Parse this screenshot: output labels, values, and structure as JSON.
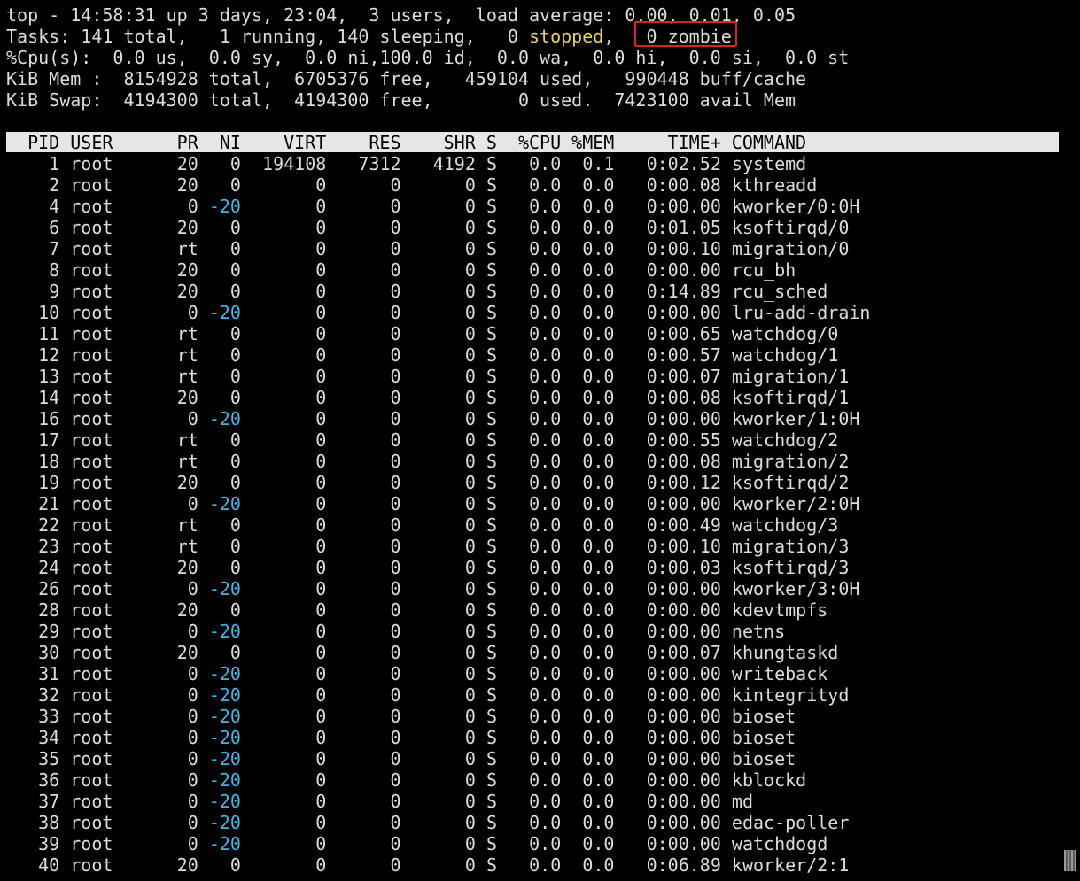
{
  "summary": {
    "line1": "top - 14:58:31 up 3 days, 23:04,  3 users,  load average: 0.00, 0.01, 0.05",
    "line2_a": "Tasks: 141 total,   1 running, 140 sleeping,   0 ",
    "line2_stopped": "stopped",
    "line2_b": ",   ",
    "line2_zombie": "0 zombie",
    "line3": "%Cpu(s):  0.0 us,  0.0 sy,  0.0 ni,100.0 id,  0.0 wa,  0.0 hi,  0.0 si,  0.0 st",
    "line4": "KiB Mem :  8154928 total,  6705376 free,   459104 used,   990448 buff/cache",
    "line5": "KiB Swap:  4194300 total,  4194300 free,        0 used.  7423100 avail Mem"
  },
  "table": {
    "header": "  PID USER      PR  NI    VIRT    RES    SHR S  %CPU %MEM     TIME+ COMMAND",
    "rows": [
      {
        "pid": "1",
        "user": "root",
        "pr": "20",
        "ni": "0",
        "virt": "194108",
        "res": "7312",
        "shr": "4192",
        "s": "S",
        "cpu": "0.0",
        "mem": "0.1",
        "time": "0:02.52",
        "cmd": "systemd"
      },
      {
        "pid": "2",
        "user": "root",
        "pr": "20",
        "ni": "0",
        "virt": "0",
        "res": "0",
        "shr": "0",
        "s": "S",
        "cpu": "0.0",
        "mem": "0.0",
        "time": "0:00.08",
        "cmd": "kthreadd"
      },
      {
        "pid": "4",
        "user": "root",
        "pr": "0",
        "ni": "-20",
        "virt": "0",
        "res": "0",
        "shr": "0",
        "s": "S",
        "cpu": "0.0",
        "mem": "0.0",
        "time": "0:00.00",
        "cmd": "kworker/0:0H"
      },
      {
        "pid": "6",
        "user": "root",
        "pr": "20",
        "ni": "0",
        "virt": "0",
        "res": "0",
        "shr": "0",
        "s": "S",
        "cpu": "0.0",
        "mem": "0.0",
        "time": "0:01.05",
        "cmd": "ksoftirqd/0"
      },
      {
        "pid": "7",
        "user": "root",
        "pr": "rt",
        "ni": "0",
        "virt": "0",
        "res": "0",
        "shr": "0",
        "s": "S",
        "cpu": "0.0",
        "mem": "0.0",
        "time": "0:00.10",
        "cmd": "migration/0"
      },
      {
        "pid": "8",
        "user": "root",
        "pr": "20",
        "ni": "0",
        "virt": "0",
        "res": "0",
        "shr": "0",
        "s": "S",
        "cpu": "0.0",
        "mem": "0.0",
        "time": "0:00.00",
        "cmd": "rcu_bh"
      },
      {
        "pid": "9",
        "user": "root",
        "pr": "20",
        "ni": "0",
        "virt": "0",
        "res": "0",
        "shr": "0",
        "s": "S",
        "cpu": "0.0",
        "mem": "0.0",
        "time": "0:14.89",
        "cmd": "rcu_sched"
      },
      {
        "pid": "10",
        "user": "root",
        "pr": "0",
        "ni": "-20",
        "virt": "0",
        "res": "0",
        "shr": "0",
        "s": "S",
        "cpu": "0.0",
        "mem": "0.0",
        "time": "0:00.00",
        "cmd": "lru-add-drain"
      },
      {
        "pid": "11",
        "user": "root",
        "pr": "rt",
        "ni": "0",
        "virt": "0",
        "res": "0",
        "shr": "0",
        "s": "S",
        "cpu": "0.0",
        "mem": "0.0",
        "time": "0:00.65",
        "cmd": "watchdog/0"
      },
      {
        "pid": "12",
        "user": "root",
        "pr": "rt",
        "ni": "0",
        "virt": "0",
        "res": "0",
        "shr": "0",
        "s": "S",
        "cpu": "0.0",
        "mem": "0.0",
        "time": "0:00.57",
        "cmd": "watchdog/1"
      },
      {
        "pid": "13",
        "user": "root",
        "pr": "rt",
        "ni": "0",
        "virt": "0",
        "res": "0",
        "shr": "0",
        "s": "S",
        "cpu": "0.0",
        "mem": "0.0",
        "time": "0:00.07",
        "cmd": "migration/1"
      },
      {
        "pid": "14",
        "user": "root",
        "pr": "20",
        "ni": "0",
        "virt": "0",
        "res": "0",
        "shr": "0",
        "s": "S",
        "cpu": "0.0",
        "mem": "0.0",
        "time": "0:00.08",
        "cmd": "ksoftirqd/1"
      },
      {
        "pid": "16",
        "user": "root",
        "pr": "0",
        "ni": "-20",
        "virt": "0",
        "res": "0",
        "shr": "0",
        "s": "S",
        "cpu": "0.0",
        "mem": "0.0",
        "time": "0:00.00",
        "cmd": "kworker/1:0H"
      },
      {
        "pid": "17",
        "user": "root",
        "pr": "rt",
        "ni": "0",
        "virt": "0",
        "res": "0",
        "shr": "0",
        "s": "S",
        "cpu": "0.0",
        "mem": "0.0",
        "time": "0:00.55",
        "cmd": "watchdog/2"
      },
      {
        "pid": "18",
        "user": "root",
        "pr": "rt",
        "ni": "0",
        "virt": "0",
        "res": "0",
        "shr": "0",
        "s": "S",
        "cpu": "0.0",
        "mem": "0.0",
        "time": "0:00.08",
        "cmd": "migration/2"
      },
      {
        "pid": "19",
        "user": "root",
        "pr": "20",
        "ni": "0",
        "virt": "0",
        "res": "0",
        "shr": "0",
        "s": "S",
        "cpu": "0.0",
        "mem": "0.0",
        "time": "0:00.12",
        "cmd": "ksoftirqd/2"
      },
      {
        "pid": "21",
        "user": "root",
        "pr": "0",
        "ni": "-20",
        "virt": "0",
        "res": "0",
        "shr": "0",
        "s": "S",
        "cpu": "0.0",
        "mem": "0.0",
        "time": "0:00.00",
        "cmd": "kworker/2:0H"
      },
      {
        "pid": "22",
        "user": "root",
        "pr": "rt",
        "ni": "0",
        "virt": "0",
        "res": "0",
        "shr": "0",
        "s": "S",
        "cpu": "0.0",
        "mem": "0.0",
        "time": "0:00.49",
        "cmd": "watchdog/3"
      },
      {
        "pid": "23",
        "user": "root",
        "pr": "rt",
        "ni": "0",
        "virt": "0",
        "res": "0",
        "shr": "0",
        "s": "S",
        "cpu": "0.0",
        "mem": "0.0",
        "time": "0:00.10",
        "cmd": "migration/3"
      },
      {
        "pid": "24",
        "user": "root",
        "pr": "20",
        "ni": "0",
        "virt": "0",
        "res": "0",
        "shr": "0",
        "s": "S",
        "cpu": "0.0",
        "mem": "0.0",
        "time": "0:00.03",
        "cmd": "ksoftirqd/3"
      },
      {
        "pid": "26",
        "user": "root",
        "pr": "0",
        "ni": "-20",
        "virt": "0",
        "res": "0",
        "shr": "0",
        "s": "S",
        "cpu": "0.0",
        "mem": "0.0",
        "time": "0:00.00",
        "cmd": "kworker/3:0H"
      },
      {
        "pid": "28",
        "user": "root",
        "pr": "20",
        "ni": "0",
        "virt": "0",
        "res": "0",
        "shr": "0",
        "s": "S",
        "cpu": "0.0",
        "mem": "0.0",
        "time": "0:00.00",
        "cmd": "kdevtmpfs"
      },
      {
        "pid": "29",
        "user": "root",
        "pr": "0",
        "ni": "-20",
        "virt": "0",
        "res": "0",
        "shr": "0",
        "s": "S",
        "cpu": "0.0",
        "mem": "0.0",
        "time": "0:00.00",
        "cmd": "netns"
      },
      {
        "pid": "30",
        "user": "root",
        "pr": "20",
        "ni": "0",
        "virt": "0",
        "res": "0",
        "shr": "0",
        "s": "S",
        "cpu": "0.0",
        "mem": "0.0",
        "time": "0:00.07",
        "cmd": "khungtaskd"
      },
      {
        "pid": "31",
        "user": "root",
        "pr": "0",
        "ni": "-20",
        "virt": "0",
        "res": "0",
        "shr": "0",
        "s": "S",
        "cpu": "0.0",
        "mem": "0.0",
        "time": "0:00.00",
        "cmd": "writeback"
      },
      {
        "pid": "32",
        "user": "root",
        "pr": "0",
        "ni": "-20",
        "virt": "0",
        "res": "0",
        "shr": "0",
        "s": "S",
        "cpu": "0.0",
        "mem": "0.0",
        "time": "0:00.00",
        "cmd": "kintegrityd"
      },
      {
        "pid": "33",
        "user": "root",
        "pr": "0",
        "ni": "-20",
        "virt": "0",
        "res": "0",
        "shr": "0",
        "s": "S",
        "cpu": "0.0",
        "mem": "0.0",
        "time": "0:00.00",
        "cmd": "bioset"
      },
      {
        "pid": "34",
        "user": "root",
        "pr": "0",
        "ni": "-20",
        "virt": "0",
        "res": "0",
        "shr": "0",
        "s": "S",
        "cpu": "0.0",
        "mem": "0.0",
        "time": "0:00.00",
        "cmd": "bioset"
      },
      {
        "pid": "35",
        "user": "root",
        "pr": "0",
        "ni": "-20",
        "virt": "0",
        "res": "0",
        "shr": "0",
        "s": "S",
        "cpu": "0.0",
        "mem": "0.0",
        "time": "0:00.00",
        "cmd": "bioset"
      },
      {
        "pid": "36",
        "user": "root",
        "pr": "0",
        "ni": "-20",
        "virt": "0",
        "res": "0",
        "shr": "0",
        "s": "S",
        "cpu": "0.0",
        "mem": "0.0",
        "time": "0:00.00",
        "cmd": "kblockd"
      },
      {
        "pid": "37",
        "user": "root",
        "pr": "0",
        "ni": "-20",
        "virt": "0",
        "res": "0",
        "shr": "0",
        "s": "S",
        "cpu": "0.0",
        "mem": "0.0",
        "time": "0:00.00",
        "cmd": "md"
      },
      {
        "pid": "38",
        "user": "root",
        "pr": "0",
        "ni": "-20",
        "virt": "0",
        "res": "0",
        "shr": "0",
        "s": "S",
        "cpu": "0.0",
        "mem": "0.0",
        "time": "0:00.00",
        "cmd": "edac-poller"
      },
      {
        "pid": "39",
        "user": "root",
        "pr": "0",
        "ni": "-20",
        "virt": "0",
        "res": "0",
        "shr": "0",
        "s": "S",
        "cpu": "0.0",
        "mem": "0.0",
        "time": "0:00.00",
        "cmd": "watchdogd"
      },
      {
        "pid": "40",
        "user": "root",
        "pr": "20",
        "ni": "0",
        "virt": "0",
        "res": "0",
        "shr": "0",
        "s": "S",
        "cpu": "0.0",
        "mem": "0.0",
        "time": "0:06.89",
        "cmd": "kworker/2:1"
      }
    ]
  },
  "colors": {
    "background": "#000000",
    "text": "#dcdcdc",
    "stopped": "#e9d34a",
    "negative_nice": "#3fb6e8",
    "highlight_box": "#e02020",
    "header_bar": "#e6e6e6"
  }
}
